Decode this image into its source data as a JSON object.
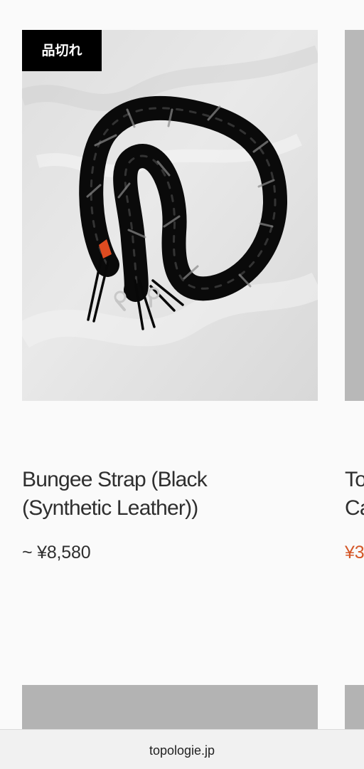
{
  "products": [
    {
      "badge": "品切れ",
      "title": "Bungee Strap (Black (Synthetic Leather))",
      "price": "~ ¥8,580",
      "image": "black-bungee-strap-photo"
    },
    {
      "title": "To\nCa",
      "price": "¥3",
      "image": "gray-placeholder"
    }
  ],
  "browser": {
    "domain": "topologie.jp"
  },
  "colors": {
    "background": "#fafafa",
    "badge_background": "#000000",
    "badge_text": "#ffffff",
    "sale_price": "#d45728",
    "placeholder": "#b3b3b3"
  }
}
